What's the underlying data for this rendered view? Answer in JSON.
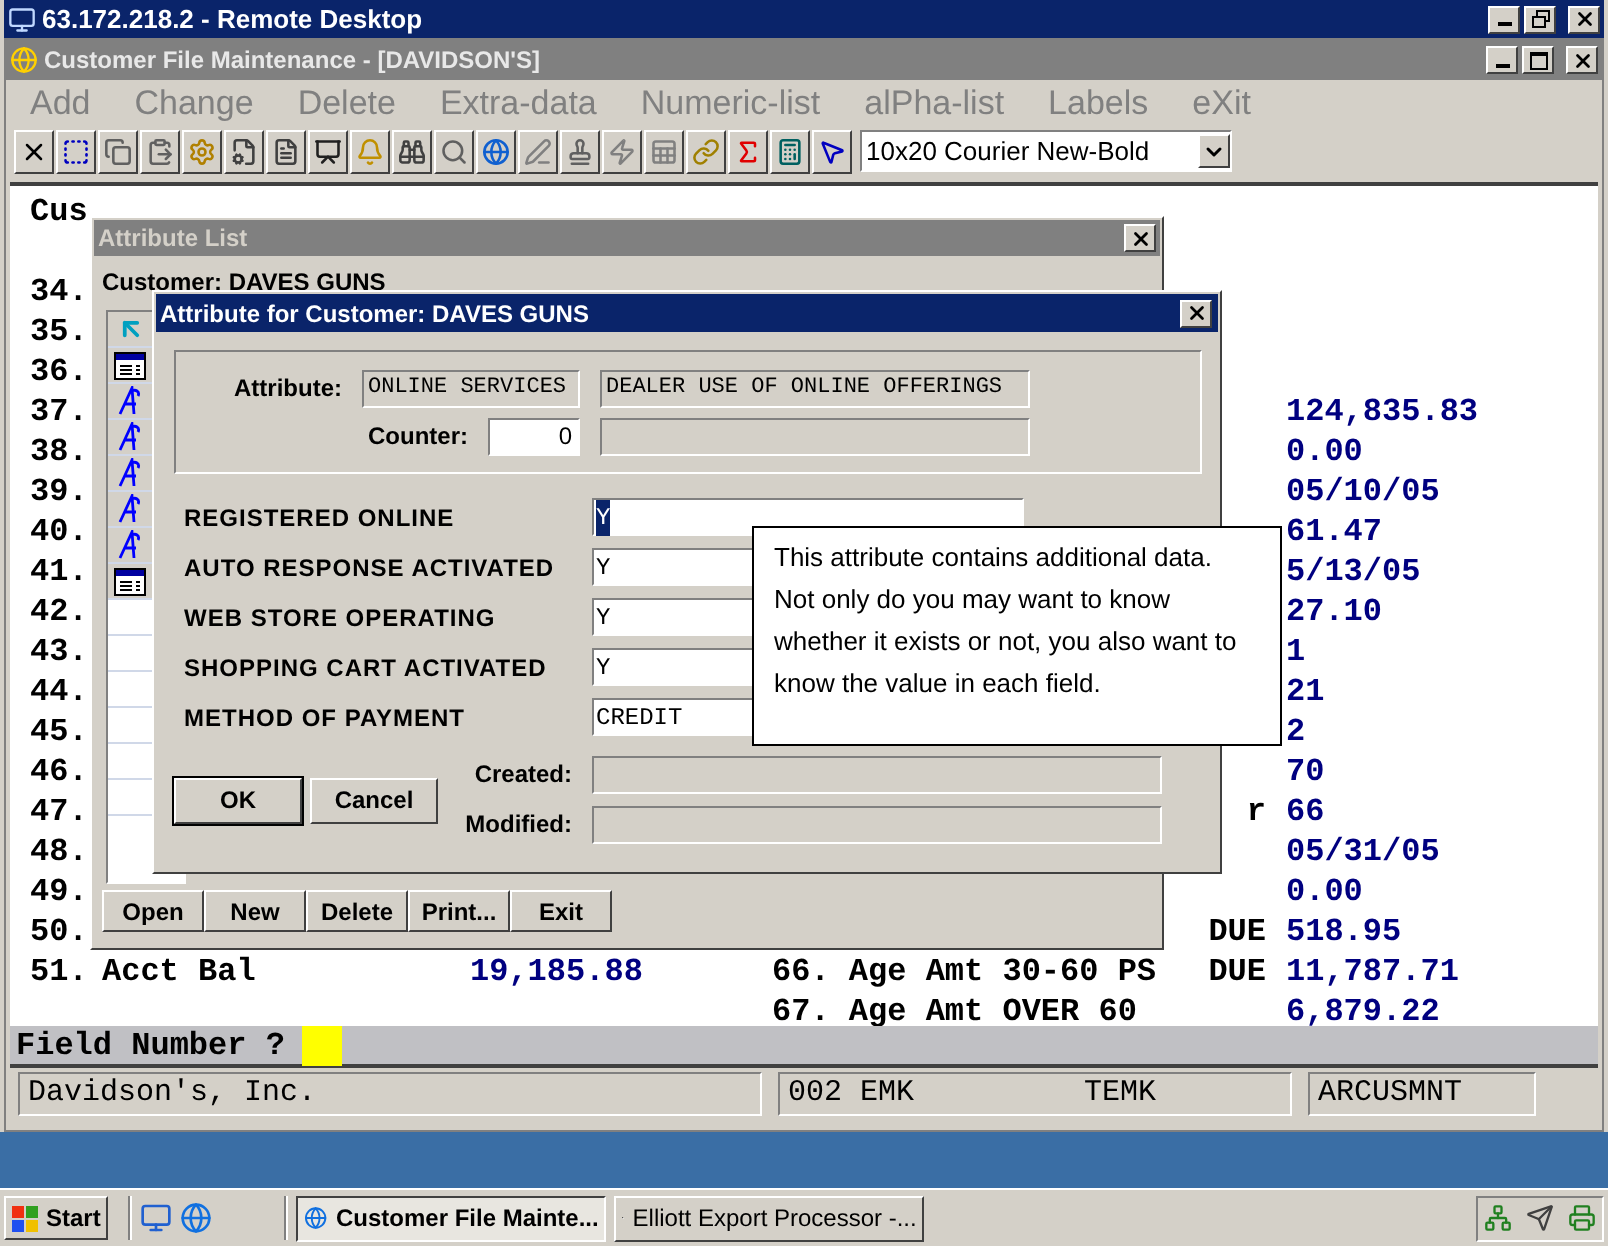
{
  "remote_window": {
    "title": "63.172.218.2 - Remote Desktop"
  },
  "app_window": {
    "title": "Customer File Maintenance - [DAVIDSON'S]"
  },
  "menu": [
    {
      "label": "Add",
      "disabled": true
    },
    {
      "label": "Change",
      "disabled": true
    },
    {
      "label": "Delete",
      "disabled": true
    },
    {
      "label": "Extra-data",
      "disabled": true
    },
    {
      "label": "Numeric-list",
      "disabled": true
    },
    {
      "label": "alPha-list",
      "disabled": true
    },
    {
      "label": "Labels",
      "disabled": true
    },
    {
      "label": "eXit",
      "disabled": true
    }
  ],
  "toolbar": {
    "font_select": "10x20 Courier New-Bold"
  },
  "terminal": {
    "customer": {
      "label": "Cus"
    },
    "lines": [
      {
        "number": "34."
      },
      {
        "number": "35."
      },
      {
        "number": "36."
      },
      {
        "number": "37.",
        "right_value": "124,835.83"
      },
      {
        "number": "38.",
        "right_value": "0.00"
      },
      {
        "number": "39.",
        "right_value": "05/10/05"
      },
      {
        "number": "40.",
        "right_value": "61.47"
      },
      {
        "number": "41.",
        "right_value": "5/13/05"
      },
      {
        "number": "42.",
        "right_value": "27.10"
      },
      {
        "number": "43.",
        "right_value": "1"
      },
      {
        "number": "44.",
        "right_value": "21"
      },
      {
        "number": "45.",
        "right_value": "2"
      },
      {
        "number": "46.",
        "right_value": "70"
      },
      {
        "number": "47.",
        "right_tag": "r",
        "right_value": "66"
      },
      {
        "number": "48.",
        "right_value": "05/31/05"
      },
      {
        "number": "49.",
        "right_value": "0.00"
      },
      {
        "number": "50.",
        "right_tag": "DUE",
        "right_value": "518.95"
      },
      {
        "number": "51.",
        "label": "Acct Bal",
        "value": "19,185.88",
        "right_label": "66. Age Amt 30-60 PS",
        "right_tag": "DUE",
        "right_value": "11,787.71"
      },
      {
        "right_label": "67. Age Amt OVER 60",
        "right_value": "6,879.22"
      }
    ]
  },
  "prompt": {
    "label": "Field Number ?"
  },
  "status_bar": {
    "company": "Davidson's, Inc.",
    "user": "002 EMK",
    "terminal": "TEMK",
    "program": "ARCUSMNT"
  },
  "attribute_list": {
    "title": "Attribute List",
    "customer": "Customer: DAVES GUNS",
    "items": [
      {
        "kind": "up"
      },
      {
        "kind": "record"
      },
      {
        "kind": "attribute"
      },
      {
        "kind": "attribute"
      },
      {
        "kind": "attribute"
      },
      {
        "kind": "attribute"
      },
      {
        "kind": "attribute"
      },
      {
        "kind": "record"
      }
    ],
    "buttons": [
      "Open",
      "New",
      "Delete",
      "Print...",
      "Exit"
    ]
  },
  "attribute_dialog": {
    "title": "Attribute for Customer: DAVES GUNS",
    "attribute_label": "Attribute:",
    "attribute_code": "ONLINE SERVICES",
    "attribute_description": "DEALER USE OF ONLINE OFFERINGS",
    "counter_label": "Counter:",
    "counter": "0",
    "fields": [
      {
        "label": "REGISTERED ONLINE",
        "value": "Y",
        "highlighted": true
      },
      {
        "label": "AUTO RESPONSE ACTIVATED",
        "value": "Y",
        "highlighted": false
      },
      {
        "label": "WEB STORE OPERATING",
        "value": "Y",
        "highlighted": false
      },
      {
        "label": "SHOPPING CART ACTIVATED",
        "value": "Y",
        "highlighted": false
      },
      {
        "label": "METHOD OF PAYMENT",
        "value": "CREDIT",
        "highlighted": false
      }
    ],
    "buttons": [
      {
        "label": "OK",
        "default": true
      },
      {
        "label": "Cancel",
        "default": false
      }
    ],
    "created_label": "Created:",
    "modified_label": "Modified:"
  },
  "tooltip": {
    "text": "This attribute contains additional data. Not only do you may want to know whether it exists or not, you also want to know the value in each field."
  },
  "taskbar": {
    "start": "Start",
    "tasks": [
      {
        "label": "Customer File Mainte...",
        "selected": true
      },
      {
        "label": "Elliott Export Processor -...",
        "selected": false
      }
    ]
  }
}
